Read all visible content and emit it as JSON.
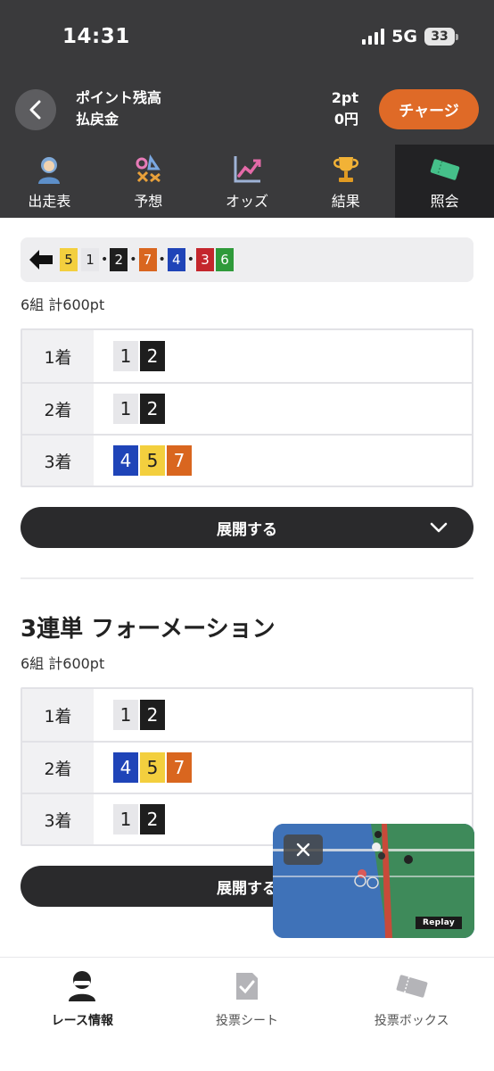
{
  "status": {
    "time": "14:31",
    "network": "5G",
    "battery": "33"
  },
  "header": {
    "label_points": "ポイント残高",
    "label_refund": "払戻金",
    "points_value": "2pt",
    "refund_value": "0円",
    "charge_label": "チャージ"
  },
  "tabs": [
    {
      "label": "出走表",
      "icon": "racer-icon",
      "active": false
    },
    {
      "label": "予想",
      "icon": "prediction-icon",
      "active": false
    },
    {
      "label": "オッズ",
      "icon": "chart-line-icon",
      "active": false
    },
    {
      "label": "結果",
      "icon": "trophy-icon",
      "active": false
    },
    {
      "label": "照会",
      "icon": "ticket-icon",
      "active": true
    }
  ],
  "pick_bar": {
    "first": "5",
    "rest": [
      "1",
      "2",
      "7",
      "4",
      "3",
      "6"
    ]
  },
  "bet1": {
    "count": "6組 計600pt",
    "rows": [
      {
        "rank": "1着",
        "nums": [
          "1",
          "2"
        ]
      },
      {
        "rank": "2着",
        "nums": [
          "1",
          "2"
        ]
      },
      {
        "rank": "3着",
        "nums": [
          "4",
          "5",
          "7"
        ]
      }
    ],
    "expand_label": "展開する"
  },
  "bet2": {
    "title": "3連単 フォーメーション",
    "count": "6組 計600pt",
    "rows": [
      {
        "rank": "1着",
        "nums": [
          "1",
          "2"
        ]
      },
      {
        "rank": "2着",
        "nums": [
          "4",
          "5",
          "7"
        ]
      },
      {
        "rank": "3着",
        "nums": [
          "1",
          "2"
        ]
      }
    ],
    "expand_label": "展開する"
  },
  "video": {
    "badge": "Replay"
  },
  "bottom_nav": [
    {
      "label": "レース情報",
      "icon": "racer-icon",
      "active": true
    },
    {
      "label": "投票シート",
      "icon": "vote-sheet-icon",
      "active": false
    },
    {
      "label": "投票ボックス",
      "icon": "vote-box-icon",
      "active": false
    }
  ],
  "colors": {
    "header_bg": "#3a3a3c",
    "charge": "#df6a27",
    "num_1": "#e7e7ea",
    "num_2": "#1e1e1e",
    "num_3": "#c4262c",
    "num_4": "#1f44b8",
    "num_5": "#f3cf3e",
    "num_6": "#2f9a3a",
    "num_7": "#d9661f"
  }
}
